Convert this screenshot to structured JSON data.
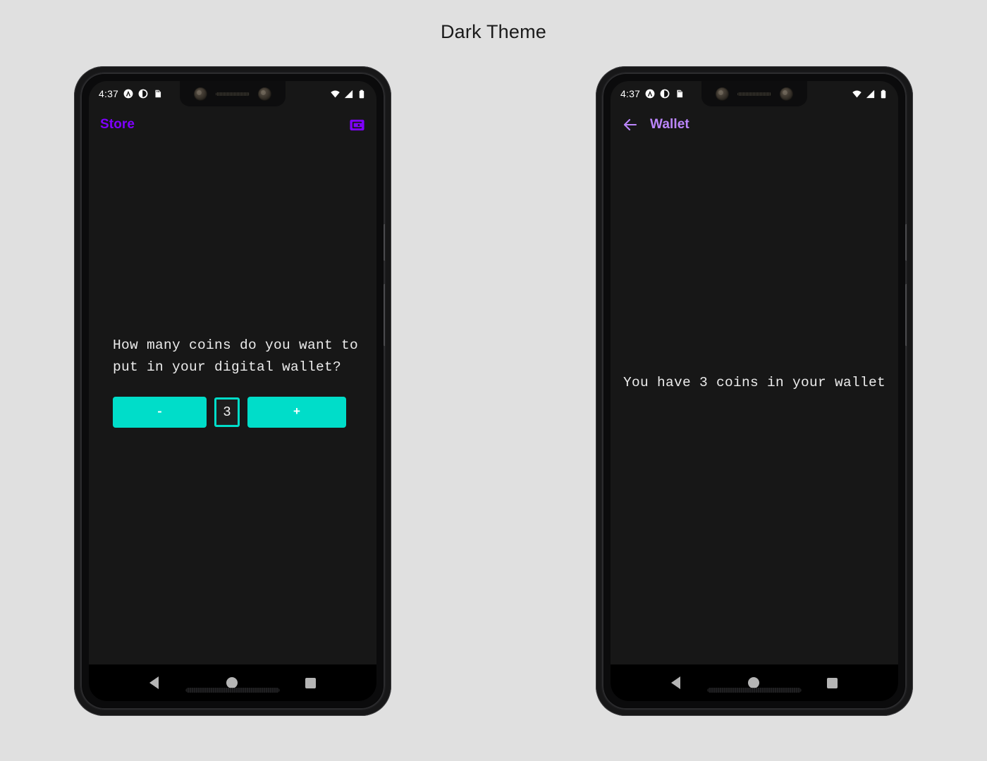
{
  "page": {
    "title": "Dark Theme",
    "background_color": "#e0e0e0"
  },
  "colors": {
    "screen_background": "#171717",
    "accent_teal": "#00ddc9",
    "primary_purple": "#7f00ff",
    "primary_purple_light": "#bb86fc",
    "text_primary": "#ececec",
    "nav_icon": "#b5b5b5"
  },
  "status_bar": {
    "time": "4:37",
    "notification_icons": [
      "android-auto-icon",
      "do-not-disturb-icon",
      "sd-card-icon"
    ],
    "right_icons": [
      "wifi-icon",
      "cell-signal-icon",
      "battery-icon"
    ]
  },
  "phones": [
    {
      "id": "store-phone",
      "app_bar": {
        "title": "Store",
        "title_color": "#7f00ff",
        "action_icon": "wallet-icon"
      },
      "content": {
        "question": "How many coins do you want to put in your digital wallet?",
        "decrement_label": "-",
        "increment_label": "+",
        "count_value": "3"
      }
    },
    {
      "id": "wallet-phone",
      "app_bar": {
        "back_icon": "arrow-left-icon",
        "title": "Wallet",
        "title_color": "#bb86fc"
      },
      "content": {
        "message": "You have 3 coins in your wallet"
      }
    }
  ],
  "nav_bar": {
    "items": [
      "back-nav-button",
      "home-nav-button",
      "recents-nav-button"
    ]
  }
}
